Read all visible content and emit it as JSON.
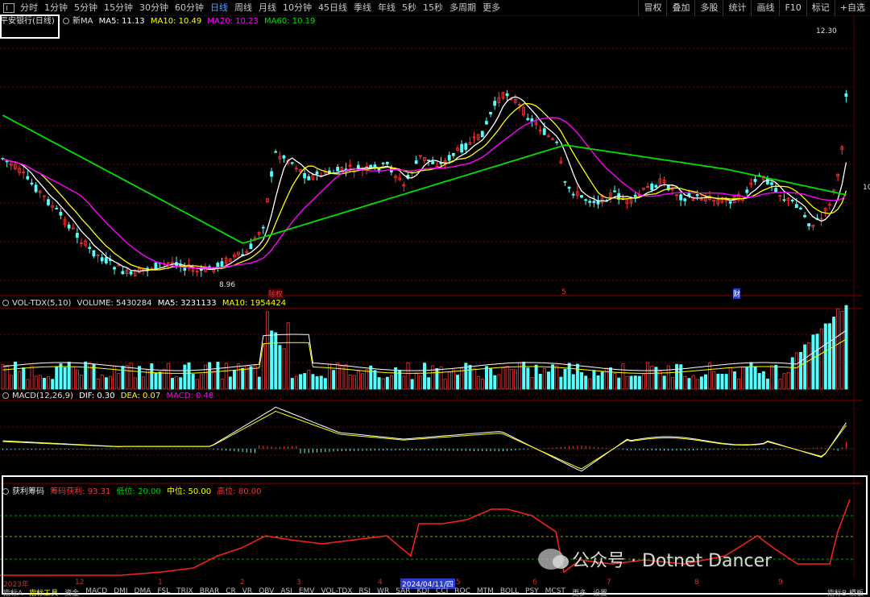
{
  "toolbar": {
    "timeframes": [
      "分时",
      "1分钟",
      "5分钟",
      "15分钟",
      "30分钟",
      "60分钟",
      "日线",
      "周线",
      "月线",
      "10分钟",
      "45日线",
      "季线",
      "年线",
      "5秒",
      "15秒",
      "多周期",
      "更多"
    ],
    "active_index": 6,
    "right_buttons": [
      "冒权",
      "叠加",
      "多股",
      "统计",
      "画线",
      "F10",
      "标记",
      "+自选"
    ]
  },
  "main_panel": {
    "stock_name": "平安银行(日线)",
    "ma_title": "新MA",
    "ma5": "MA5: 11.13",
    "ma10": "MA10: 10.49",
    "ma20": "MA20: 10.23",
    "ma60": "MA60: 10.19",
    "high_label": "12.30",
    "low_label": "8.96",
    "right_axis_tag": "10",
    "events": [
      "除权",
      "5",
      "财"
    ]
  },
  "volume_panel": {
    "title": "VOL-TDX(5,10)",
    "volume": "VOLUME: 5430284",
    "ma5": "MA5: 3231133",
    "ma10": "MA10: 1954424"
  },
  "macd_panel": {
    "title": "MACD(12,26,9)",
    "dif": "DIF: 0.30",
    "dea": "DEA: 0.07",
    "macd": "MACD: 0.48"
  },
  "chip_panel": {
    "title": "获利筹码",
    "profit": "筹码获利: 93.31",
    "low": "低位: 20.00",
    "mid": "中位: 50.00",
    "high": "高位: 80.00"
  },
  "date_axis": {
    "labels": [
      "2023年",
      "12",
      "1",
      "2",
      "3",
      "4",
      "2024/04/11/四",
      "5",
      "6",
      "7",
      "8",
      "9"
    ]
  },
  "bottom_tabs": [
    "指标A",
    "指标工具",
    "资金",
    "MACD",
    "DMI",
    "DMA",
    "FSL",
    "TRIX",
    "BRAR",
    "CR",
    "VR",
    "OBV",
    "ASI",
    "EMV",
    "VOL-TDX",
    "RSI",
    "WR",
    "SAR",
    "KDJ",
    "CCI",
    "ROC",
    "MTM",
    "BOLL",
    "PSY",
    "MCST",
    "更多",
    "设置"
  ],
  "bottom_right": [
    "指标B",
    "模板"
  ],
  "watermark": "公众号 · Dotnet Dancer",
  "colors": {
    "up": "#ff3232",
    "down": "#54ffff",
    "ma5": "#ffffff",
    "ma10": "#ffff00",
    "ma20": "#ff00ff",
    "ma60": "#00e000",
    "grid": "#7a0000"
  }
}
